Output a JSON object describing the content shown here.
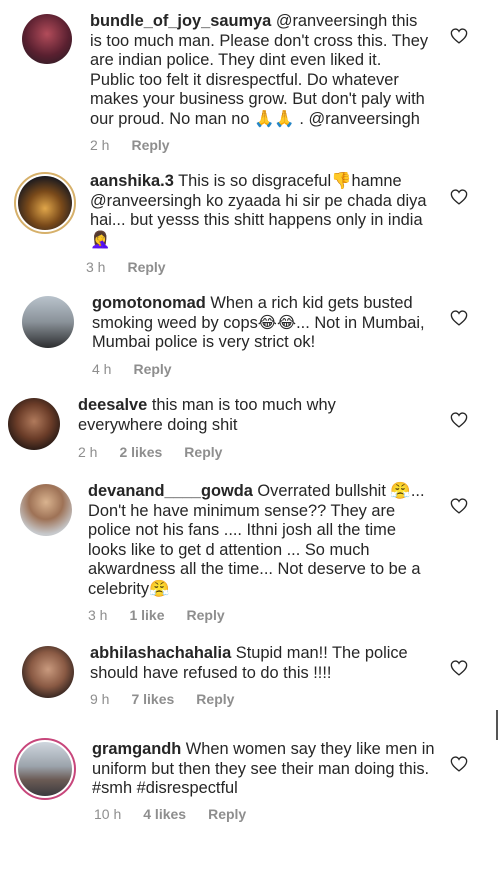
{
  "comments": [
    {
      "username": "bundle_of_joy_saumya",
      "text": " @ranveersingh this is too much man. Please don't cross this. They are indian police. They dint even liked it. Public too felt it disrespectful. Do whatever makes your business grow. But don't paly with our proud. No man no 🙏🙏 . @ranveersingh",
      "time": "2 h",
      "likes": "",
      "reply": "Reply"
    },
    {
      "username": "aanshika.3",
      "text": " This is so disgraceful👎hamne @ranveersingh ko zyaada hi sir pe chada diya hai... but yesss this shitt happens only in india🤦‍♀️",
      "time": "3 h",
      "likes": "",
      "reply": "Reply"
    },
    {
      "username": "gomotonomad",
      "text": " When a rich kid gets busted smoking weed by cops😂😂... Not in Mumbai, Mumbai police is very strict ok!",
      "time": "4 h",
      "likes": "",
      "reply": "Reply"
    },
    {
      "username": "deesalve",
      "text": " this man is too much why everywhere doing shit",
      "time": "2 h",
      "likes": "2 likes",
      "reply": "Reply"
    },
    {
      "username": "devanand____gowda",
      "text": " Overrated bullshit 😤... Don't he have minimum sense?? They are police not his fans .... Ithni josh all the time looks like to get d attention ... So much akwardness all the time... Not deserve to be a celebrity😤",
      "time": "3 h",
      "likes": "1 like",
      "reply": "Reply"
    },
    {
      "username": "abhilashachahalia",
      "text": " Stupid man!! The police should have refused to do this !!!!",
      "time": "9 h",
      "likes": "7 likes",
      "reply": "Reply"
    },
    {
      "username": "gramgandh",
      "text": " When women say they like men in uniform but then they see their man doing this. #smh #disrespectful",
      "time": "10 h",
      "likes": "4 likes",
      "reply": "Reply"
    }
  ],
  "icons": {
    "like": "heart-outline-icon"
  },
  "colors": {
    "text": "#262626",
    "meta": "#8e8e8e",
    "story_ring": "#d6b06a"
  }
}
